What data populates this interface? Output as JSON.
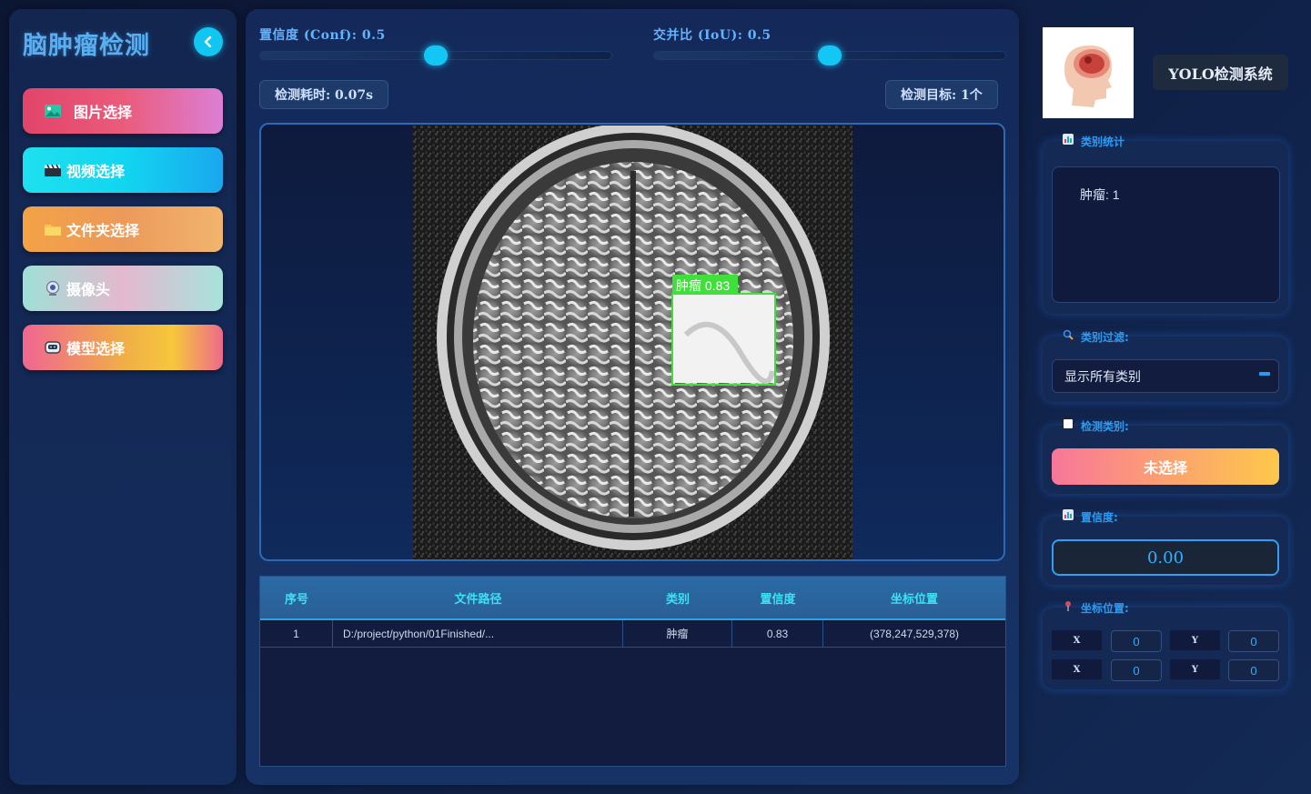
{
  "app": {
    "title": "脑肿瘤检测",
    "system_title": "YOLO检测系统"
  },
  "sidebar": {
    "items": [
      {
        "label": "图片选择",
        "icon": "image-icon"
      },
      {
        "label": "视频选择",
        "icon": "clapperboard-icon"
      },
      {
        "label": "文件夹选择",
        "icon": "folder-icon"
      },
      {
        "label": "摄像头",
        "icon": "webcam-icon"
      },
      {
        "label": "模型选择",
        "icon": "robot-icon"
      }
    ]
  },
  "controls": {
    "conf_label": "置信度 (Conf): 0.5",
    "conf_value": 0.5,
    "iou_label": "交并比 (IoU): 0.5",
    "iou_value": 0.5,
    "time_label": "检测耗时: 0.07s",
    "target_label": "检测目标: 1个"
  },
  "detection": {
    "box_label": "肿瘤 0.83",
    "box_color": "#3fe03a"
  },
  "table": {
    "headers": [
      "序号",
      "文件路径",
      "类别",
      "置信度",
      "坐标位置"
    ],
    "rows": [
      {
        "index": "1",
        "path": "D:/project/python/01Finished/...",
        "category": "肿瘤",
        "confidence": "0.83",
        "coords": "(378,247,529,378)"
      }
    ]
  },
  "right": {
    "stats_label": "类别统计",
    "stats_text": "肿瘤: 1",
    "filter_label": "类别过滤:",
    "filter_value": "显示所有类别",
    "detect_class_label": "检测类别:",
    "detect_class_value": "未选择",
    "conf_label": "置信度:",
    "conf_value": "0.00",
    "coords_label": "坐标位置:",
    "coords": [
      {
        "key": "X",
        "value": "0"
      },
      {
        "key": "Y",
        "value": "0"
      },
      {
        "key": "X",
        "value": "0"
      },
      {
        "key": "Y",
        "value": "0"
      }
    ]
  },
  "colors": {
    "accent": "#12c6f2",
    "label_blue": "#2f9bf0",
    "panel": "#142a55"
  }
}
